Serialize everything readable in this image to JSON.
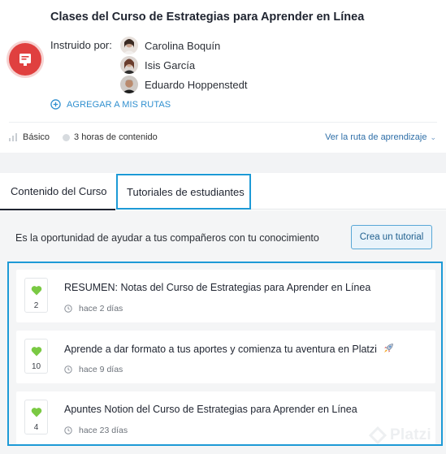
{
  "course": {
    "title": "Clases del Curso de Estrategias para Aprender en Línea",
    "badge_icon": "document-icon",
    "badge_color": "#e0403f",
    "instructed_by_label": "Instruido por:",
    "instructors": [
      {
        "name": "Carolina Boquín"
      },
      {
        "name": "Isis García"
      },
      {
        "name": "Eduardo Hoppenstedt"
      }
    ],
    "add_route_label": "AGREGAR A MIS RUTAS",
    "level": "Básico",
    "duration": "3 horas de contenido",
    "learning_path_link": "Ver la ruta de aprendizaje"
  },
  "tabs": [
    {
      "label": "Contenido del Curso"
    },
    {
      "label": "Tutoriales de estudiantes"
    }
  ],
  "tutorials_section": {
    "promo_text": "Es la oportunidad de ayudar a tus compañeros con tu conocimiento",
    "create_button": "Crea un tutorial",
    "items": [
      {
        "votes": "2",
        "title": "RESUMEN: Notas del Curso de Estrategias para Aprender en Línea",
        "time": "hace 2 días"
      },
      {
        "votes": "10",
        "title": "Aprende a dar formato a tus aportes y comienza tu aventura en Platzi",
        "time": "hace 9 días"
      },
      {
        "votes": "4",
        "title": "Apuntes Notion del Curso de Estrategias para Aprender en Línea",
        "time": "hace 23 días"
      }
    ]
  },
  "watermark": "Platzi",
  "colors": {
    "accent": "#1d9ad6",
    "link": "#2f8fcf",
    "heart": "#7ac943"
  }
}
